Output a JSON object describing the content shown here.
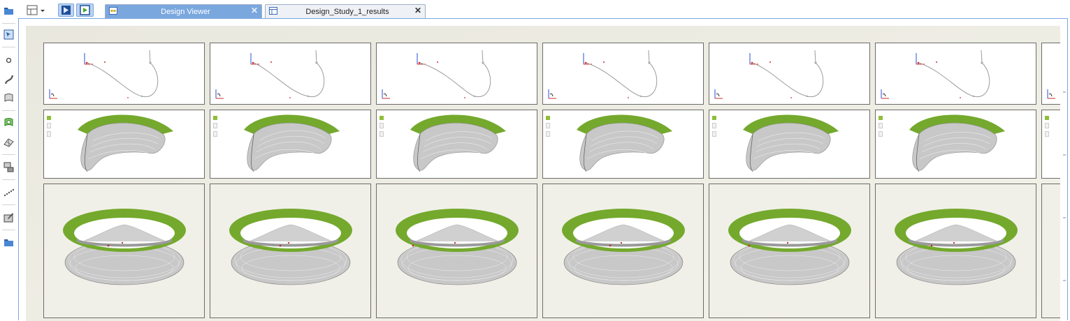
{
  "tabs": [
    {
      "label": "Design Viewer",
      "active": true
    },
    {
      "label": "Design_Study_1_results",
      "active": false
    }
  ],
  "close_glyph": "✕",
  "left_toolbar": [
    "folder-icon",
    "select-icon",
    "point-icon",
    "curve-icon",
    "surface-icon",
    "region-icon",
    "mesh-icon",
    "shape-icon",
    "dotted-line-icon",
    "edit-icon",
    "folder-icon"
  ],
  "top_toolbar": [
    "layout-icon",
    "back-icon",
    "play-icon"
  ],
  "colors": {
    "accent": "#7ba7df",
    "ring_green": "#74a92d",
    "label_green": "#8fbf3a",
    "surface_gray": "#c8c8c8"
  },
  "designs": [
    {
      "id": 1
    },
    {
      "id": 2
    },
    {
      "id": 3
    },
    {
      "id": 4
    },
    {
      "id": 5
    },
    {
      "id": 6
    },
    {
      "id": 7
    }
  ]
}
